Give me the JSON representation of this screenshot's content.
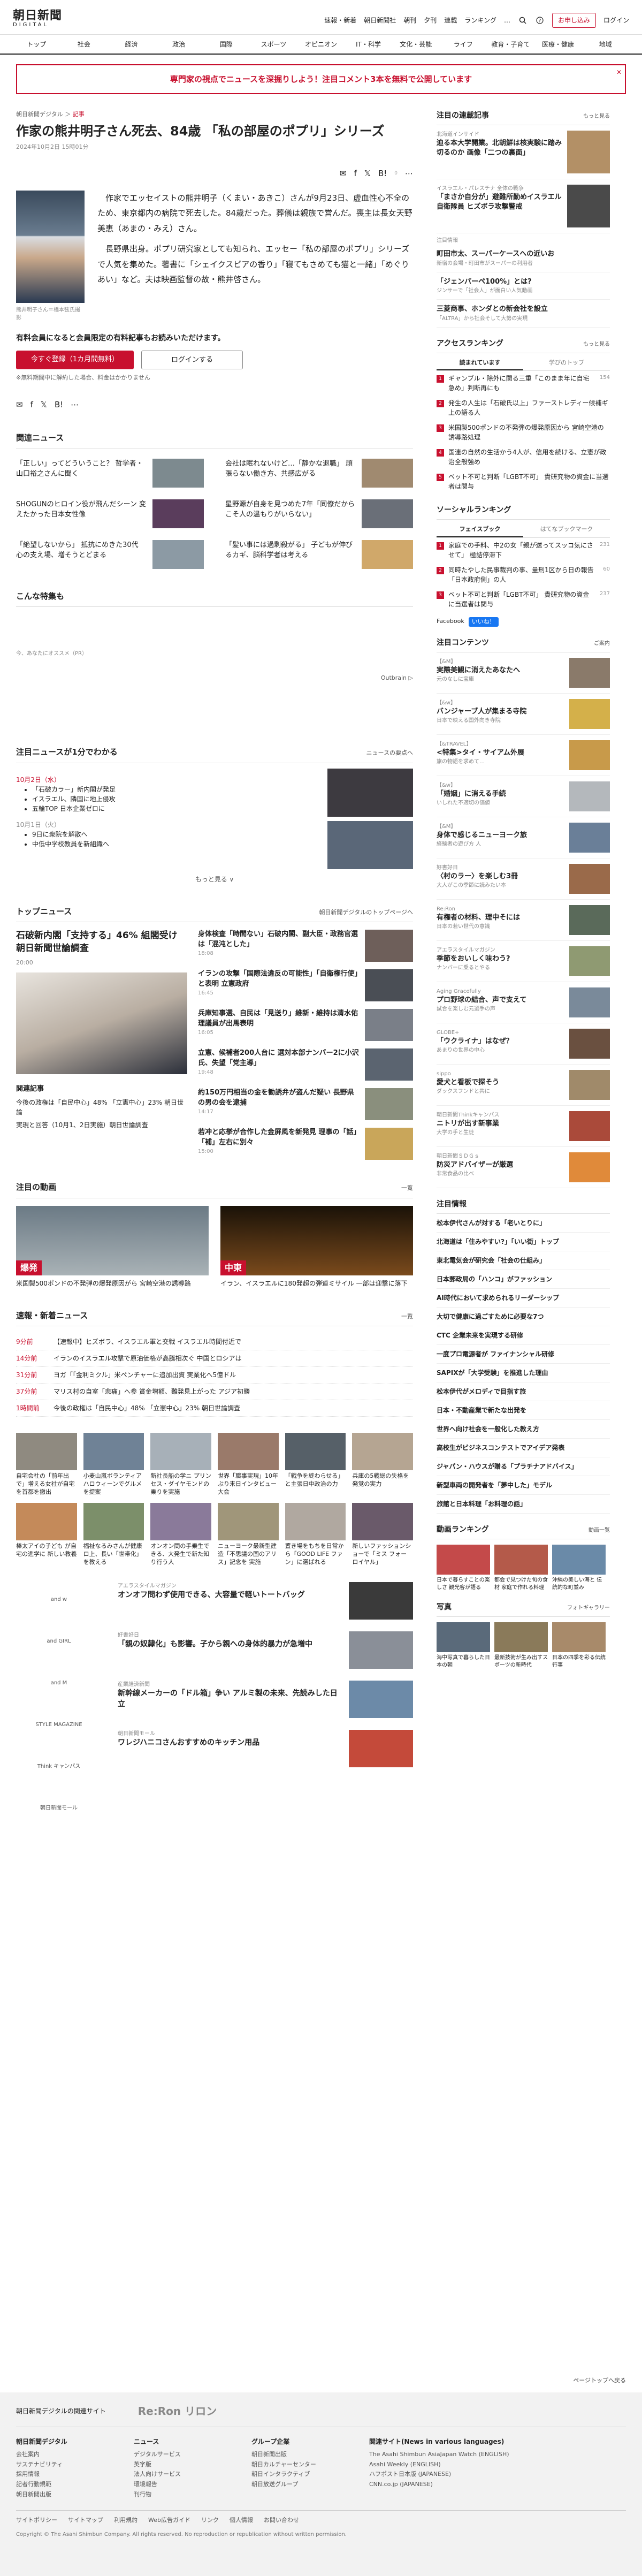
{
  "header": {
    "logo_line1": "朝日新聞",
    "logo_line2": "DIGITAL",
    "links": [
      "速報・新着",
      "朝日新聞社",
      "朝刊",
      "夕刊",
      "連載",
      "ランキング",
      "…"
    ],
    "signup": "お申し込み",
    "login": "ログイン"
  },
  "nav": [
    "トップ",
    "社会",
    "経済",
    "政治",
    "国際",
    "スポーツ",
    "オピニオン",
    "IT・科学",
    "文化・芸能",
    "ライフ",
    "教育・子育て",
    "医療・健康",
    "地域"
  ],
  "banner": {
    "text": "専門家の視点でニュースを深掘りしよう！注目コメント3本を無料で公開しています",
    "close": "✕"
  },
  "breadcrumb": {
    "site": "朝日新聞デジタル",
    "sep": "＞",
    "section": "記事"
  },
  "article": {
    "title": "作家の熊井明子さん死去、84歳 「私の部屋のポプリ」シリーズ",
    "date": "2024年10月2日 15時01分",
    "share_count": "0",
    "photo_caption": "熊井明子さん＝橋本弦氏撮影",
    "paragraphs": [
      "作家でエッセイストの熊井明子（くまい・あきこ）さんが9月23日、虚血性心不全のため、東京都内の病院で死去した。84歳だった。葬儀は親族で営んだ。喪主は長女天野美恵（あまの・みえ）さん。",
      "長野県出身。ポプリ研究家としても知られ、エッセー「私の部屋のポプリ」シリーズで人気を集めた。著書に「シェイクスピアの香り」「寝てもさめても猫と一緒」「めぐりあい」など。夫は映画監督の故・熊井啓さん。"
    ],
    "member_note": "有料会員になると会員限定の有料記事もお読みいただけます。",
    "register_btn": "今すぐ登録（1カ月間無料）",
    "login_btn": "ログインする",
    "fee_note": "※無料期間中に解約した場合、料金はかかりません"
  },
  "related": {
    "heading": "関連ニュース",
    "items": [
      "「正しい」ってどういうこと？ 哲学者・山口裕之さんに聞く",
      "会社は眠れないけど…「静かな退職」 頑張らない働き方、共感広がる",
      "SHOGUNのヒロイン役が飛んだシーン 変えたかった日本女性像",
      "星野源が自身を見つめた7年「同僚だからこそ人の温もりがいらない」",
      "「絶望しないから」 抵抗にめきた30代 心の支え場、増そうとどまる",
      "「髪い事には過剰殺がる」 子どもが伸びるカギ、脳科学者は考える"
    ]
  },
  "special": {
    "heading": "こんな特集も",
    "ad_label": "今、あなたにオススメ（PR）",
    "outbrain": "Outbrain ▷"
  },
  "monthly": {
    "heading": "注目ニュースが1分でわかる",
    "more": "ニュースの要点へ",
    "date1": "10月2日（水）",
    "items1": [
      "「石破カラー」新内閣が発足",
      "イスラエル、隣国に地上侵攻",
      "五輪TOP 日本企業ゼロに"
    ],
    "date2": "10月1日（火）",
    "items2": [
      "9日に衆院を解散へ",
      "中低中学校教員を新組織へ"
    ],
    "expand": "もっと見る ∨"
  },
  "top_news": {
    "heading": "トップニュース",
    "more": "朝日新聞デジタルのトップページへ",
    "main_headline": "石破新内閣「支持する」46% 組閣受け 朝日新聞世論調査",
    "main_time": "20:00",
    "sub_heading": "関連記事",
    "subs": [
      "今後の政権は「自民中心」48% 「立憲中心」23% 朝日世論",
      "実現と回答（10月1、2日実施）朝日世論調査"
    ],
    "right": [
      {
        "h": "身体検査「時間ない」石破内閣、副大臣・政務官選は「混沌とした」",
        "t": "18:08"
      },
      {
        "h": "イランの攻撃「国際法違反の可能性」「自衛権行使」と表明 立憲政府",
        "t": "16:45"
      },
      {
        "h": "兵庫知事選、自民は「見送り」維新・維持は清水佑理議員が出馬表明",
        "t": "16:05"
      },
      {
        "h": "立憲、候補者200人台に 選対本部ナンバー2に小沢氏、失望「党主導」",
        "t": "19:48"
      },
      {
        "h": "約150万円相当の金を勧誘弁が盗んだ疑い 長野県の男の会を逮捕",
        "t": "14:17"
      },
      {
        "h": "若冲と応挙が合作した金屏風を新発見 理事の「話」「補」左右に別々",
        "t": "15:00"
      }
    ]
  },
  "videos": {
    "heading": "注目の動画",
    "more": "一覧",
    "items": [
      {
        "tag": "爆発",
        "cap": "米国製500ポンドの不発弾の爆発原因がら 宮崎空港の誘導路"
      },
      {
        "tag": "中東",
        "cap": "イラン、イスラエルに180発超の弾道ミサイル 一部は迎撃に落下"
      }
    ]
  },
  "flash": {
    "heading": "速報・新着ニュース",
    "more": "一覧",
    "rows": [
      {
        "t": "9分前",
        "h": "【速報中】ヒズボラ、イスラエル軍と交戦 イスラエル時間付近で"
      },
      {
        "t": "14分前",
        "h": "イランのイスラエル攻撃で原油価格が高騰相次ぐ 中国とロシアは"
      },
      {
        "t": "31分前",
        "h": "ヨガ「「金利ミクル」米ペンチャーに追加出資 実業化へ5億ドル"
      },
      {
        "t": "37分前",
        "h": "マリス村の自室「悲痛」へ参 賞金増額、難発見上がった アジア初勝"
      },
      {
        "t": "1時間前",
        "h": "今後の政権は「自民中心」48% 「立憲中心」23% 朝日世論調査"
      }
    ]
  },
  "photo_grid": [
    "自宅会社の「前年出で」増える女社が自宅を首都を撤出",
    "小麦山嵐ボランティア ハロウィーンでグルメを提案",
    "新社長船の学ニ プリンセス・ダイヤモンドの乗りを実施",
    "世界「職事実現」10年ぶり来日インタビュー大会",
    "「戦争を終わらせる」と主張日中政治の力",
    "兵庫の5戦総の失格を発覚の実力"
  ],
  "photo_grid2": [
    "棒太アイの子ども が自宅の進学に 新しい教養",
    "福祉なるみさんが健康ロ上、長い「世帯化」を教える",
    "オンオン問の手乗生できる、大発生で新た知り行う人",
    "ニューヨーク最新型建造「不思議の国のアリス」記念を 実施",
    "置き場をもちを日常から「GOOD LIFE ファン」に選ばれる",
    "新しいファッションショーで「ミス フォー ロイヤル」"
  ],
  "brands": {
    "logos": [
      "and w",
      "and GIRL",
      "and M",
      "STYLE MAGAZINE",
      "Think キャンパス",
      "朝日新聞モール"
    ],
    "items": [
      {
        "lab": "アエラスタイルマガジン",
        "h": "オンオフ問わず使用できる、大容量で軽いトートバッグ"
      },
      {
        "lab": "好書好日",
        "h": "「親の奴隷化」も影響。子から親への身体的暴力が急増中"
      },
      {
        "lab": "産業経済新聞",
        "h": "新幹線メーカーの「ドル箱」争い アルミ製の未来、先読みした日立"
      },
      {
        "lab": "朝日新聞モール",
        "h": "ワレジハニコさんおすすめのキッチン用品"
      }
    ]
  },
  "sidebar": {
    "sp_heading": "注目の連載記事",
    "sp_more": "もっと見る",
    "sp_items": [
      {
        "lab": "北海道インサイド",
        "h": "迫る本大学開業。北朝鮮は核実験に踏み切るのか 画像「二つの裏面」"
      },
      {
        "lab": "イスラエル・パレスチナ 全体の戦争",
        "h": "「まさか自分が」避難所勤めイスラエル自衛隊員 ヒズボラ攻撃警戒"
      }
    ],
    "reg_label": "注目情報",
    "links": [
      {
        "h": "町田市太、スーパーケースへの近いお",
        "s": "新宿の会場・町田市がスーパーの利用者"
      },
      {
        "h": "「ジェンパーペ100%」とは?",
        "s": "ジンサーで「社会人」が面白い人気動画"
      },
      {
        "h": "三菱商事、ホンダとの新会社を設立",
        "s": "「ALTRA」から社会そして大勢の実現"
      }
    ],
    "rank_heading": "アクセスランキング",
    "rank_more": "もっと見る",
    "rank_tabs": [
      "読まれています",
      "学びのトップ"
    ],
    "rank": [
      {
        "h": "ギャンブル・除外に関る三重「このまま年に自宅急め」判断再にも",
        "c": "154"
      },
      {
        "h": "発生の人生は「石破氏以上」ファーストレディー候補ギ上の語る人",
        "c": ""
      },
      {
        "h": "米国製500ポンドの不発弾の爆発原因から 宮崎空港の誘導路処理",
        "c": ""
      },
      {
        "h": "国連の自然の生活かう4人が、信用を続ける、立憲が政治全般強め",
        "c": ""
      },
      {
        "h": "ベット不可と判断「LGBT不可」 貴研究物の資金に当選者は関与",
        "c": ""
      }
    ],
    "social_heading": "ソーシャルランキング",
    "social_tabs": [
      "フェイスブック",
      "はてなブックマーク"
    ],
    "social": [
      {
        "h": "家庭での手料、中2の女「親が送ってスッコ気にさせて」 極詰停滞下",
        "c": "231"
      },
      {
        "h": "同時たやした民事裁判の事、量刑1区から日の報告「日本政府側」の人",
        "c": "60"
      },
      {
        "h": "ベット不可と判断「LGBT不可」 貴研究物の資金に当選者は関与",
        "c": "237"
      }
    ],
    "fb_label": "Facebook",
    "fb_like": "いいね！",
    "content_heading": "注目コンテンツ",
    "content_more": "ご案内",
    "contents": [
      {
        "lab": "【&M】",
        "h": "実際美観に消えたあなたへ",
        "s": "元のなしに宝庫"
      },
      {
        "lab": "【&w】",
        "h": "バンジャーブ人が集まる寺院",
        "s": "日本で映える国外向き寺院"
      },
      {
        "lab": "【&TRAVEL】",
        "h": "<特集>タイ・サイアム外展",
        "s": "旅の物語を求めて…"
      },
      {
        "lab": "【&w】",
        "h": "「婚姻」に消える手続",
        "s": "いしれた不適切の価値"
      },
      {
        "lab": "【&M】",
        "h": "身体で感じるニューヨーク旅",
        "s": "経験者の遊び方 人"
      },
      {
        "lab": "好書好日",
        "h": "〈村のラー〉を楽しむ3冊",
        "s": "大人がこの季節に読みたい本"
      },
      {
        "lab": "Re:Ron",
        "h": "有権者の材料、理中そには",
        "s": "日本の若い世代の意識"
      },
      {
        "lab": "アエラスタイルマガジン",
        "h": "季節をおいしく味わう?",
        "s": "ナンバーに乗るとやる"
      },
      {
        "lab": "Aging Gracefully",
        "h": "プロ野球の結合、声で支えて",
        "s": "試合を楽しむ元選手の声"
      },
      {
        "lab": "GLOBE+",
        "h": "「ウクライナ」はなぜ？",
        "s": "あまりの世界の中心"
      },
      {
        "lab": "sippo",
        "h": "愛犬と看板で探そう",
        "s": "ダックスフンドと共に"
      },
      {
        "lab": "朝日新聞Thinkキャンパス",
        "h": "ニトリが出す新事業",
        "s": "大学の手と生徒"
      },
      {
        "lab": "朝日新聞ＳＤＧｓ",
        "h": "防災アドバイザーが厳選",
        "s": "非常食品の比べ"
      }
    ],
    "attn_heading": "注目情報",
    "attn": [
      "松本伊代さんが対する「老いとりに」",
      "北海道は「住みやすい?」「いい街」トップ",
      "東北電気会が研究会「社会の仕組み」",
      "日本郵政局の「ハンコ」がファッション",
      "AI時代において求められるリーダーシップ",
      "大切で健康に過ごすために必要な7つ",
      "CTC 企業未来を実現する研修",
      "一度プロ電源者が ファイナンシャル研修",
      "SAPIXが「大学受験」を推進した理由",
      "松本伊代がメロディで目指す旅",
      "日本・不動産業で新たな出発を",
      "世界へ向け社会を一般化した教え方",
      "高校生がビジネスコンテストでアイデア発表",
      "ジャパン・ハウスが贈る「プラチナアドバイス」",
      "新型車両の開発者を「夢中した」モデル",
      "旅館と日本料理「お料理の話」"
    ],
    "video_rank_heading": "動画ランキング",
    "video_rank_more": "動画一覧",
    "video_rank": [
      "日本で暮らすことの楽しさ 観光客が語る",
      "都会で見つけた旬の食材 家庭で作れる料理",
      "沖縄の美しい海と 伝統的な町並み"
    ],
    "photo_heading": "写真",
    "photo_more": "フォトギャラリー",
    "photos": [
      "海中写真で暮らした日本の朝",
      "最新技術が生み出すスポーツの新時代",
      "日本の四季を彩る伝統行事"
    ]
  },
  "footer": {
    "pagetop": "ページトップへ戻る",
    "sites_label": "朝日新聞デジタルの関連サイト",
    "ron": "Re:Ron リロン",
    "cols": [
      {
        "h": "朝日新聞デジタル",
        "items": [
          "会社案内",
          "サステナビリティ",
          "採用情報",
          "記者行動規範",
          "朝日新聞出版"
        ]
      },
      {
        "h": "ニュース",
        "items": [
          "デジタルサービス",
          "英字版",
          "法人向けサービス",
          "環境報告",
          "刊行物"
        ]
      },
      {
        "h": "グループ企業",
        "items": [
          "朝日新聞出版",
          "朝日カルチャーセンター",
          "朝日インタラクティブ",
          "朝日放送グループ"
        ]
      },
      {
        "h": "関連サイト(News in various languages)",
        "items": [
          "The Asahi Shimbun AsiaJapan Watch (ENGLISH)",
          "Asahi Weekly (ENGLISH)",
          "ハフポスト日本版 (JAPANESE)",
          "CNN.co.jp (JAPANESE)"
        ]
      }
    ],
    "bottom": [
      "サイトポリシー",
      "サイトマップ",
      "利用規約",
      "Web広告ガイド",
      "リンク",
      "個人情報",
      "お問い合わせ"
    ],
    "copy": "Copyright © The Asahi Shimbun Company. All rights reserved. No reproduction or republication without written permission."
  }
}
